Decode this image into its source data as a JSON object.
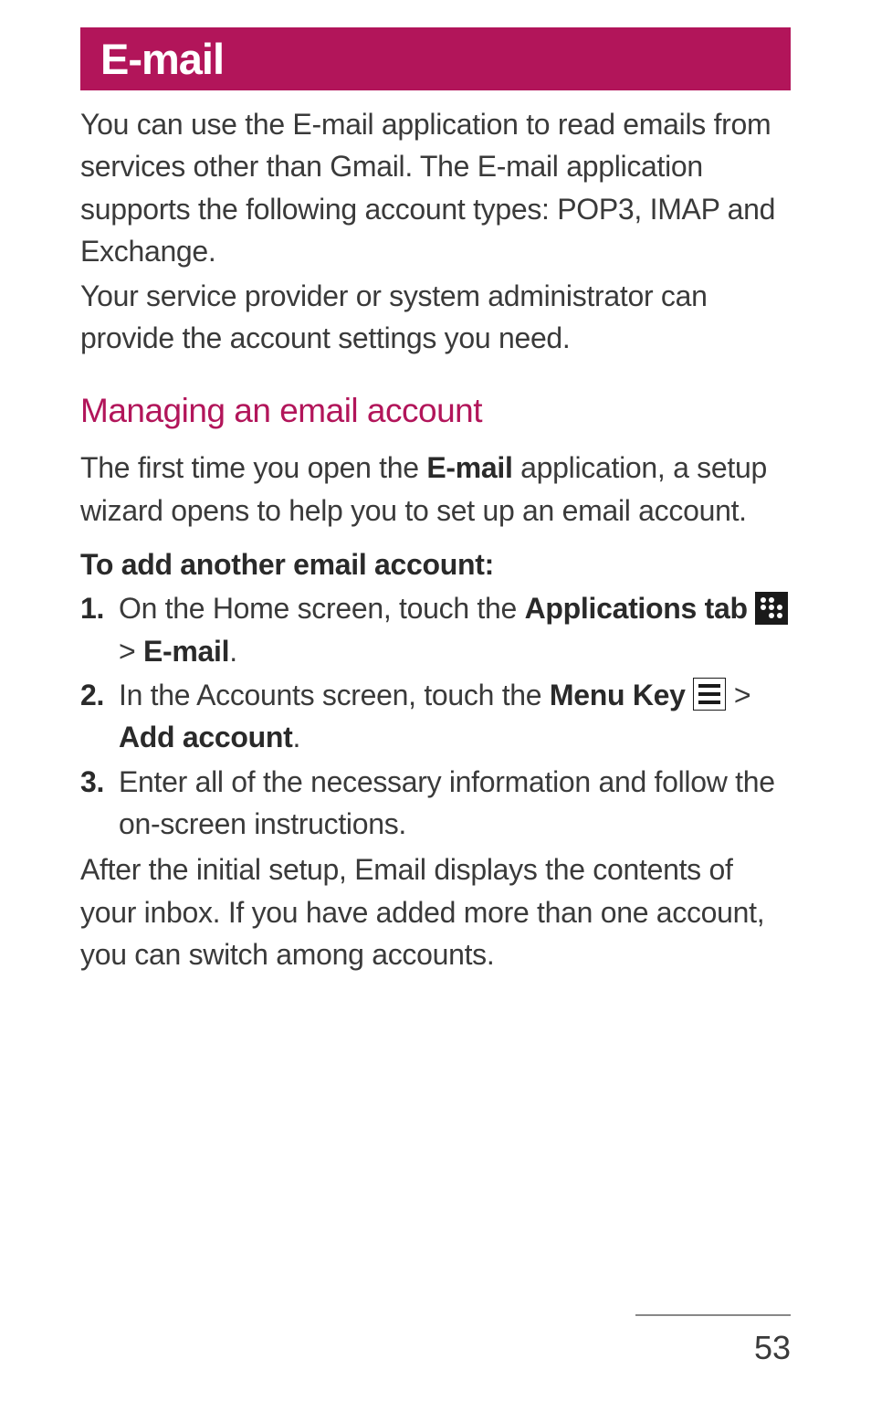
{
  "header": {
    "title": "E-mail"
  },
  "intro": {
    "p1": "You can use the E-mail application to read emails from services other than Gmail. The E-mail application supports the following account types: POP3, IMAP and Exchange.",
    "p2": "Your service provider or system administrator can provide the account settings you need."
  },
  "section": {
    "heading": "Managing an email account",
    "intro_pre": "The first time you open the ",
    "intro_bold": "E-mail",
    "intro_post": " application, a setup wizard opens to help you to set up an email account.",
    "subheading": "To add another email account:",
    "steps": {
      "s1": {
        "num": "1.",
        "pre": " On the Home screen, touch the ",
        "bold1": "Applications tab",
        "sep": " > ",
        "bold2": "E-mail",
        "post": "."
      },
      "s2": {
        "num": "2.",
        "pre": " In the Accounts screen, touch the ",
        "bold1": "Menu Key",
        "sep": " > ",
        "bold2": "Add account",
        "post": "."
      },
      "s3": {
        "num": "3.",
        "text": " Enter all of the necessary information and follow the on-screen instructions."
      }
    },
    "outro": "After the initial setup, Email displays the contents of your inbox. If you have added more than one account, you can switch among accounts."
  },
  "footer": {
    "page": "53"
  }
}
